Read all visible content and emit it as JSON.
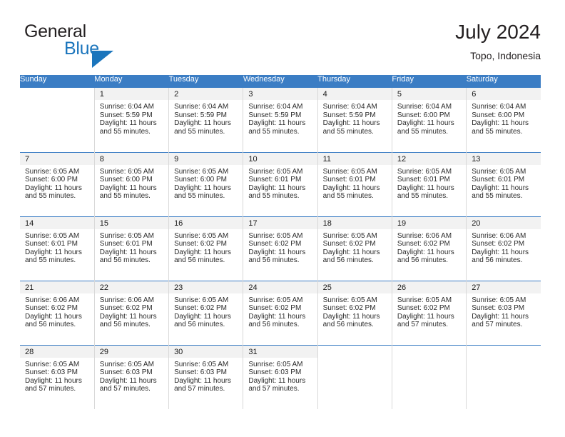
{
  "brand": {
    "name_part1": "General",
    "name_part2": "Blue",
    "logo_icon": "triangle-flag-icon",
    "accent_color": "#1b75bc"
  },
  "header": {
    "title": "July 2024",
    "subtitle": "Topo, Indonesia"
  },
  "calendar": {
    "header_color": "#3b7dc4",
    "weekday_headers": [
      "Sunday",
      "Monday",
      "Tuesday",
      "Wednesday",
      "Thursday",
      "Friday",
      "Saturday"
    ],
    "weeks": [
      [
        {
          "day": "",
          "sunrise": "",
          "sunset": "",
          "daylight1": "",
          "daylight2": ""
        },
        {
          "day": "1",
          "sunrise": "Sunrise: 6:04 AM",
          "sunset": "Sunset: 5:59 PM",
          "daylight1": "Daylight: 11 hours",
          "daylight2": "and 55 minutes."
        },
        {
          "day": "2",
          "sunrise": "Sunrise: 6:04 AM",
          "sunset": "Sunset: 5:59 PM",
          "daylight1": "Daylight: 11 hours",
          "daylight2": "and 55 minutes."
        },
        {
          "day": "3",
          "sunrise": "Sunrise: 6:04 AM",
          "sunset": "Sunset: 5:59 PM",
          "daylight1": "Daylight: 11 hours",
          "daylight2": "and 55 minutes."
        },
        {
          "day": "4",
          "sunrise": "Sunrise: 6:04 AM",
          "sunset": "Sunset: 5:59 PM",
          "daylight1": "Daylight: 11 hours",
          "daylight2": "and 55 minutes."
        },
        {
          "day": "5",
          "sunrise": "Sunrise: 6:04 AM",
          "sunset": "Sunset: 6:00 PM",
          "daylight1": "Daylight: 11 hours",
          "daylight2": "and 55 minutes."
        },
        {
          "day": "6",
          "sunrise": "Sunrise: 6:04 AM",
          "sunset": "Sunset: 6:00 PM",
          "daylight1": "Daylight: 11 hours",
          "daylight2": "and 55 minutes."
        }
      ],
      [
        {
          "day": "7",
          "sunrise": "Sunrise: 6:05 AM",
          "sunset": "Sunset: 6:00 PM",
          "daylight1": "Daylight: 11 hours",
          "daylight2": "and 55 minutes."
        },
        {
          "day": "8",
          "sunrise": "Sunrise: 6:05 AM",
          "sunset": "Sunset: 6:00 PM",
          "daylight1": "Daylight: 11 hours",
          "daylight2": "and 55 minutes."
        },
        {
          "day": "9",
          "sunrise": "Sunrise: 6:05 AM",
          "sunset": "Sunset: 6:00 PM",
          "daylight1": "Daylight: 11 hours",
          "daylight2": "and 55 minutes."
        },
        {
          "day": "10",
          "sunrise": "Sunrise: 6:05 AM",
          "sunset": "Sunset: 6:01 PM",
          "daylight1": "Daylight: 11 hours",
          "daylight2": "and 55 minutes."
        },
        {
          "day": "11",
          "sunrise": "Sunrise: 6:05 AM",
          "sunset": "Sunset: 6:01 PM",
          "daylight1": "Daylight: 11 hours",
          "daylight2": "and 55 minutes."
        },
        {
          "day": "12",
          "sunrise": "Sunrise: 6:05 AM",
          "sunset": "Sunset: 6:01 PM",
          "daylight1": "Daylight: 11 hours",
          "daylight2": "and 55 minutes."
        },
        {
          "day": "13",
          "sunrise": "Sunrise: 6:05 AM",
          "sunset": "Sunset: 6:01 PM",
          "daylight1": "Daylight: 11 hours",
          "daylight2": "and 55 minutes."
        }
      ],
      [
        {
          "day": "14",
          "sunrise": "Sunrise: 6:05 AM",
          "sunset": "Sunset: 6:01 PM",
          "daylight1": "Daylight: 11 hours",
          "daylight2": "and 55 minutes."
        },
        {
          "day": "15",
          "sunrise": "Sunrise: 6:05 AM",
          "sunset": "Sunset: 6:01 PM",
          "daylight1": "Daylight: 11 hours",
          "daylight2": "and 56 minutes."
        },
        {
          "day": "16",
          "sunrise": "Sunrise: 6:05 AM",
          "sunset": "Sunset: 6:02 PM",
          "daylight1": "Daylight: 11 hours",
          "daylight2": "and 56 minutes."
        },
        {
          "day": "17",
          "sunrise": "Sunrise: 6:05 AM",
          "sunset": "Sunset: 6:02 PM",
          "daylight1": "Daylight: 11 hours",
          "daylight2": "and 56 minutes."
        },
        {
          "day": "18",
          "sunrise": "Sunrise: 6:05 AM",
          "sunset": "Sunset: 6:02 PM",
          "daylight1": "Daylight: 11 hours",
          "daylight2": "and 56 minutes."
        },
        {
          "day": "19",
          "sunrise": "Sunrise: 6:06 AM",
          "sunset": "Sunset: 6:02 PM",
          "daylight1": "Daylight: 11 hours",
          "daylight2": "and 56 minutes."
        },
        {
          "day": "20",
          "sunrise": "Sunrise: 6:06 AM",
          "sunset": "Sunset: 6:02 PM",
          "daylight1": "Daylight: 11 hours",
          "daylight2": "and 56 minutes."
        }
      ],
      [
        {
          "day": "21",
          "sunrise": "Sunrise: 6:06 AM",
          "sunset": "Sunset: 6:02 PM",
          "daylight1": "Daylight: 11 hours",
          "daylight2": "and 56 minutes."
        },
        {
          "day": "22",
          "sunrise": "Sunrise: 6:06 AM",
          "sunset": "Sunset: 6:02 PM",
          "daylight1": "Daylight: 11 hours",
          "daylight2": "and 56 minutes."
        },
        {
          "day": "23",
          "sunrise": "Sunrise: 6:05 AM",
          "sunset": "Sunset: 6:02 PM",
          "daylight1": "Daylight: 11 hours",
          "daylight2": "and 56 minutes."
        },
        {
          "day": "24",
          "sunrise": "Sunrise: 6:05 AM",
          "sunset": "Sunset: 6:02 PM",
          "daylight1": "Daylight: 11 hours",
          "daylight2": "and 56 minutes."
        },
        {
          "day": "25",
          "sunrise": "Sunrise: 6:05 AM",
          "sunset": "Sunset: 6:02 PM",
          "daylight1": "Daylight: 11 hours",
          "daylight2": "and 56 minutes."
        },
        {
          "day": "26",
          "sunrise": "Sunrise: 6:05 AM",
          "sunset": "Sunset: 6:02 PM",
          "daylight1": "Daylight: 11 hours",
          "daylight2": "and 57 minutes."
        },
        {
          "day": "27",
          "sunrise": "Sunrise: 6:05 AM",
          "sunset": "Sunset: 6:03 PM",
          "daylight1": "Daylight: 11 hours",
          "daylight2": "and 57 minutes."
        }
      ],
      [
        {
          "day": "28",
          "sunrise": "Sunrise: 6:05 AM",
          "sunset": "Sunset: 6:03 PM",
          "daylight1": "Daylight: 11 hours",
          "daylight2": "and 57 minutes."
        },
        {
          "day": "29",
          "sunrise": "Sunrise: 6:05 AM",
          "sunset": "Sunset: 6:03 PM",
          "daylight1": "Daylight: 11 hours",
          "daylight2": "and 57 minutes."
        },
        {
          "day": "30",
          "sunrise": "Sunrise: 6:05 AM",
          "sunset": "Sunset: 6:03 PM",
          "daylight1": "Daylight: 11 hours",
          "daylight2": "and 57 minutes."
        },
        {
          "day": "31",
          "sunrise": "Sunrise: 6:05 AM",
          "sunset": "Sunset: 6:03 PM",
          "daylight1": "Daylight: 11 hours",
          "daylight2": "and 57 minutes."
        },
        {
          "day": "",
          "sunrise": "",
          "sunset": "",
          "daylight1": "",
          "daylight2": ""
        },
        {
          "day": "",
          "sunrise": "",
          "sunset": "",
          "daylight1": "",
          "daylight2": ""
        },
        {
          "day": "",
          "sunrise": "",
          "sunset": "",
          "daylight1": "",
          "daylight2": ""
        }
      ]
    ]
  }
}
